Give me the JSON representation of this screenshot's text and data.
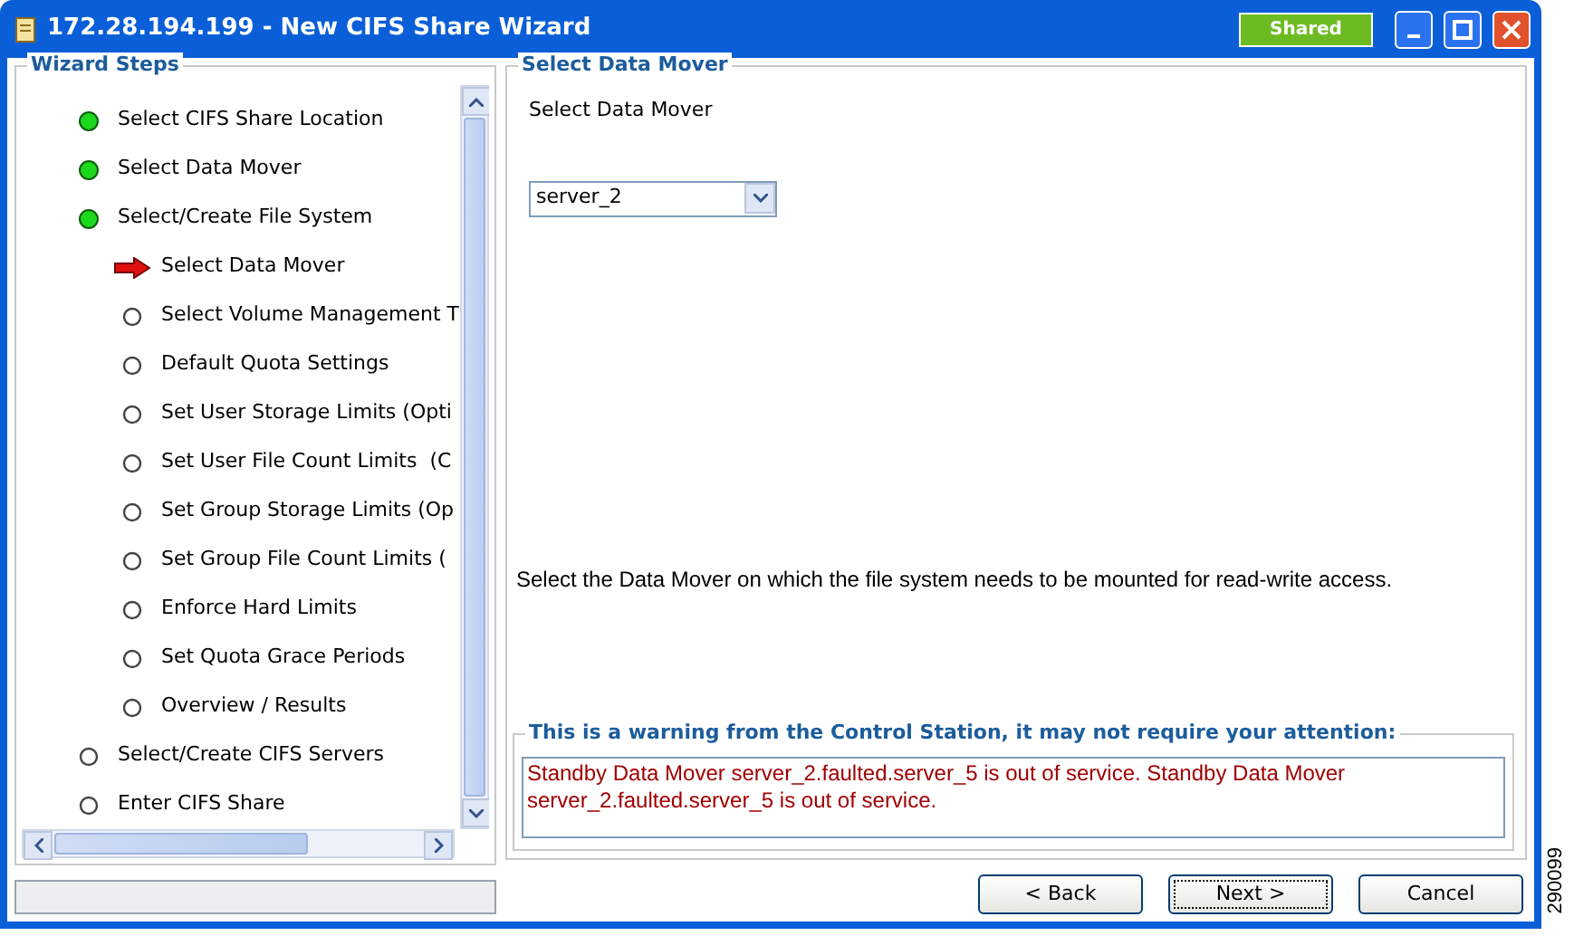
{
  "window": {
    "title": "172.28.194.199 - New CIFS Share Wizard",
    "badge": "Shared"
  },
  "wizard_steps": {
    "title": "Wizard Steps",
    "items": [
      {
        "label": "Select CIFS Share Location",
        "completed": true,
        "current": false
      },
      {
        "label": "Select Data Mover",
        "completed": true,
        "current": false
      },
      {
        "label": "Select/Create File System",
        "completed": true,
        "current": false,
        "children": [
          {
            "label": "Select Data Mover",
            "completed": false,
            "current": true
          },
          {
            "label": "Select Volume Management T",
            "completed": false,
            "current": false
          },
          {
            "label": "Default Quota Settings",
            "completed": false,
            "current": false
          },
          {
            "label": "Set User Storage Limits (Opti",
            "completed": false,
            "current": false
          },
          {
            "label": "Set User File Count Limits  (C",
            "completed": false,
            "current": false
          },
          {
            "label": "Set Group Storage Limits (Op",
            "completed": false,
            "current": false
          },
          {
            "label": "Set Group File Count Limits (",
            "completed": false,
            "current": false
          },
          {
            "label": "Enforce Hard Limits",
            "completed": false,
            "current": false
          },
          {
            "label": "Set Quota Grace Periods",
            "completed": false,
            "current": false
          },
          {
            "label": "Overview / Results",
            "completed": false,
            "current": false
          }
        ]
      },
      {
        "label": "Select/Create CIFS Servers",
        "completed": false,
        "current": false
      },
      {
        "label": "Enter CIFS Share",
        "completed": false,
        "current": false
      }
    ]
  },
  "main": {
    "title": "Select Data Mover",
    "prompt": "Select Data Mover",
    "dropdown": {
      "value": "server_2"
    },
    "description": "Select the Data Mover on which the file system needs to be mounted for read-write access.",
    "warning": {
      "title": "This is a warning from the Control Station, it may not require your attention:",
      "text": "Standby Data Mover server_2.faulted.server_5 is out of service. Standby Data Mover server_2.faulted.server_5 is out of service."
    }
  },
  "buttons": [
    {
      "label": "< Back",
      "focused": false
    },
    {
      "label": "Next >",
      "focused": true
    },
    {
      "label": "Cancel",
      "focused": false
    }
  ],
  "figure_id": "290099"
}
